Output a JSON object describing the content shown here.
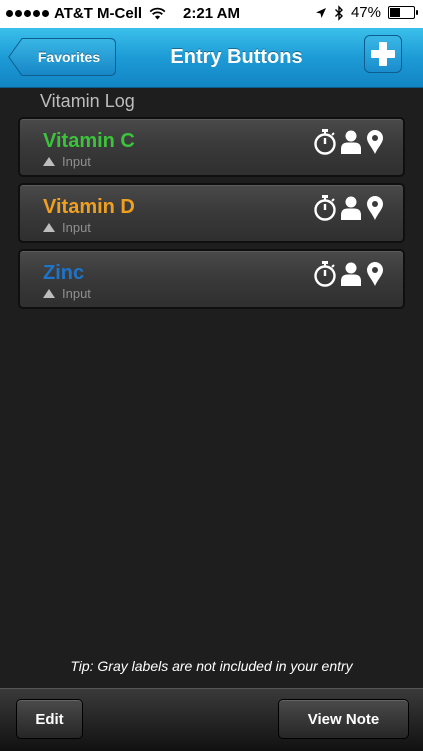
{
  "status_bar": {
    "carrier": "AT&T M-Cell",
    "time": "2:21 AM",
    "battery_percent": "47%",
    "battery_level": 0.47,
    "icons": [
      "signal-dots-icon",
      "wifi-icon",
      "location-arrow-icon",
      "bluetooth-icon",
      "battery-icon"
    ]
  },
  "nav": {
    "back_label": "Favorites",
    "title": "Entry Buttons",
    "add_icon": "plus-icon"
  },
  "section_title": "Vitamin Log",
  "entries": [
    {
      "name": "Vitamin C",
      "sub_label": "Input",
      "color": "#3cc33c"
    },
    {
      "name": "Vitamin D",
      "sub_label": "Input",
      "color": "#f0a020"
    },
    {
      "name": "Zinc",
      "sub_label": "Input",
      "color": "#1d74c8"
    }
  ],
  "entry_icons": [
    "stopwatch-icon",
    "person-icon",
    "location-pin-icon"
  ],
  "tip": "Tip: Gray labels are not included in your entry",
  "toolbar": {
    "edit_label": "Edit",
    "view_note_label": "View Note"
  },
  "colors": {
    "nav_blue": "#1d9bd6",
    "background": "#1e1e1e"
  }
}
